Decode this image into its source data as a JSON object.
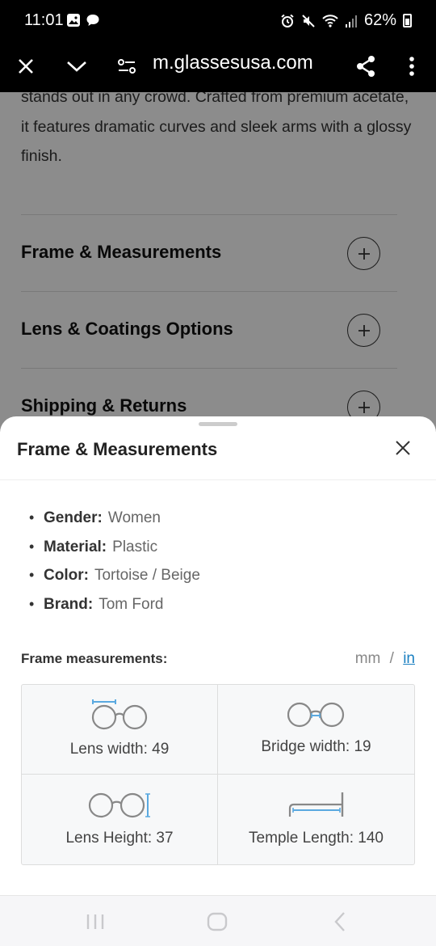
{
  "status_bar": {
    "time": "11:01",
    "battery": "62%"
  },
  "browser": {
    "url": "m.glassesusa.com"
  },
  "page": {
    "description": "stands out in any crowd. Crafted from premium acetate, it features dramatic curves and sleek arms with a glossy finish.",
    "accordions": [
      {
        "title": "Frame & Measurements"
      },
      {
        "title": "Lens & Coatings Options"
      },
      {
        "title": "Shipping & Returns"
      }
    ]
  },
  "sheet": {
    "title": "Frame & Measurements",
    "properties": [
      {
        "key": "Gender:",
        "value": "Women"
      },
      {
        "key": "Material:",
        "value": "Plastic"
      },
      {
        "key": "Color:",
        "value": "Tortoise / Beige"
      },
      {
        "key": "Brand:",
        "value": "Tom Ford"
      }
    ],
    "measurements_title": "Frame measurements:",
    "units": {
      "mm": "mm",
      "sep": "/",
      "in": "in"
    },
    "measurements": [
      {
        "label": "Lens width: 49",
        "icon": "lens-width-icon"
      },
      {
        "label": "Bridge width: 19",
        "icon": "bridge-width-icon"
      },
      {
        "label": "Lens Height: 37",
        "icon": "lens-height-icon"
      },
      {
        "label": "Temple Length: 140",
        "icon": "temple-length-icon"
      }
    ]
  },
  "colors": {
    "accent_link": "#1a7fc1",
    "measure_highlight": "#5aa9e0"
  }
}
